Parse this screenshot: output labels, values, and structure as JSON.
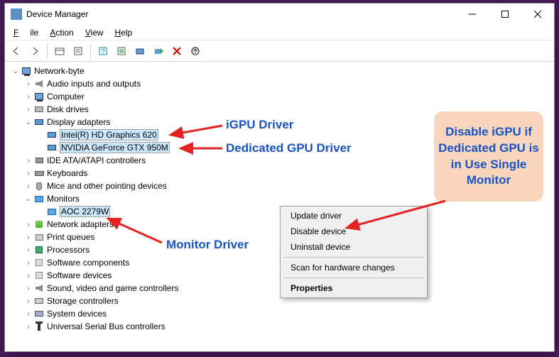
{
  "window": {
    "title": "Device Manager"
  },
  "menu": {
    "file": "File",
    "action": "Action",
    "view": "View",
    "help": "Help"
  },
  "toolbar": {
    "back": "back",
    "fwd": "forward",
    "sep": "|",
    "btns": [
      "show-hidden",
      "properties",
      "help",
      "scan",
      "update",
      "monitor",
      "enable",
      "disable",
      "uninstall"
    ]
  },
  "tree": {
    "root": "Network-byte",
    "items": [
      {
        "id": "audio",
        "label": "Audio inputs and outputs",
        "icon": "speaker",
        "expanded": false,
        "indent": 1
      },
      {
        "id": "computer",
        "label": "Computer",
        "icon": "pc",
        "expanded": false,
        "indent": 1
      },
      {
        "id": "disk",
        "label": "Disk drives",
        "icon": "disk",
        "expanded": false,
        "indent": 1
      },
      {
        "id": "display",
        "label": "Display adapters",
        "icon": "display",
        "expanded": true,
        "indent": 1
      },
      {
        "id": "igpu",
        "label": "Intel(R) HD Graphics 620",
        "icon": "display",
        "indent": 2,
        "sel": true
      },
      {
        "id": "dgpu",
        "label": "NVIDIA GeForce GTX 950M",
        "icon": "display",
        "indent": 2,
        "sel": true
      },
      {
        "id": "ide",
        "label": "IDE ATA/ATAPI controllers",
        "icon": "ide",
        "expanded": false,
        "indent": 1
      },
      {
        "id": "kb",
        "label": "Keyboards",
        "icon": "kb",
        "expanded": false,
        "indent": 1
      },
      {
        "id": "mice",
        "label": "Mice and other pointing devices",
        "icon": "mouse",
        "expanded": false,
        "indent": 1
      },
      {
        "id": "monitors",
        "label": "Monitors",
        "icon": "mon",
        "expanded": true,
        "indent": 1
      },
      {
        "id": "aoc",
        "label": "AOC 2279W",
        "icon": "mon",
        "indent": 2,
        "sel": true
      },
      {
        "id": "net",
        "label": "Network adapters",
        "icon": "net",
        "expanded": false,
        "indent": 1
      },
      {
        "id": "pq",
        "label": "Print queues",
        "icon": "queue",
        "expanded": false,
        "indent": 1
      },
      {
        "id": "proc",
        "label": "Processors",
        "icon": "cpu",
        "expanded": false,
        "indent": 1
      },
      {
        "id": "swc",
        "label": "Software components",
        "icon": "sw",
        "expanded": false,
        "indent": 1
      },
      {
        "id": "swd",
        "label": "Software devices",
        "icon": "sw",
        "expanded": false,
        "indent": 1
      },
      {
        "id": "snd",
        "label": "Sound, video and game controllers",
        "icon": "snd",
        "expanded": false,
        "indent": 1
      },
      {
        "id": "stor",
        "label": "Storage controllers",
        "icon": "store",
        "expanded": false,
        "indent": 1
      },
      {
        "id": "sys",
        "label": "System devices",
        "icon": "sys",
        "expanded": false,
        "indent": 1
      },
      {
        "id": "usb",
        "label": "Universal Serial Bus controllers",
        "icon": "usb",
        "expanded": false,
        "indent": 1
      }
    ]
  },
  "context": {
    "update": "Update driver",
    "disable": "Disable device",
    "uninstall": "Uninstall device",
    "scan": "Scan for hardware changes",
    "properties": "Properties"
  },
  "annotations": {
    "igpu": "iGPU Driver",
    "dgpu": "Dedicated GPU Driver",
    "monitor": "Monitor Driver",
    "callout": "Disable iGPU if Dedicated GPU is in Use Single Monitor"
  }
}
